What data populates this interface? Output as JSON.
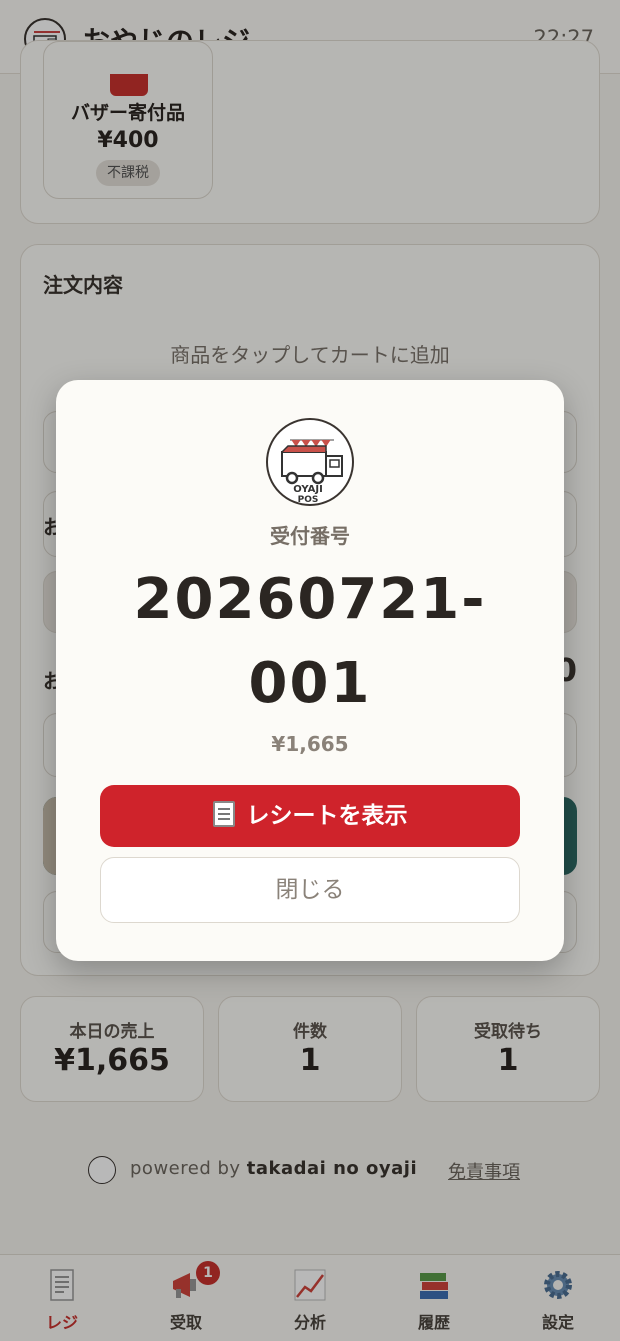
{
  "header": {
    "title": "おやじのレジ",
    "time": "22:27",
    "logo_icon": "oyaji-pos-logo-icon"
  },
  "product": {
    "name": "バザー寄付品",
    "price": "¥400",
    "tax": "不課税",
    "icon": "gift-icon"
  },
  "order": {
    "title": "注文内容",
    "empty": "商品をタップしてカートに追加",
    "partial_1": "お",
    "partial_2": "お",
    "partial_amount": "0"
  },
  "stats": [
    {
      "label": "本日の売上",
      "value": "¥1,665"
    },
    {
      "label": "件数",
      "value": "1"
    },
    {
      "label": "受取待ち",
      "value": "1"
    }
  ],
  "footer": {
    "powered_prefix": "powered by ",
    "powered_name": "takadai no oyaji",
    "disclaimer": "免責事項"
  },
  "tabs": [
    {
      "label": "レジ",
      "icon": "receipt-icon",
      "active": true
    },
    {
      "label": "受取",
      "icon": "megaphone-icon",
      "badge": "1"
    },
    {
      "label": "分析",
      "icon": "chart-icon"
    },
    {
      "label": "履歴",
      "icon": "books-icon"
    },
    {
      "label": "設定",
      "icon": "gear-icon"
    }
  ],
  "modal": {
    "label": "受付番号",
    "number_line1": "20260721-",
    "number_line2": "001",
    "amount": "¥1,665",
    "primary_button": "レシートを表示",
    "secondary_button": "閉じる",
    "logo_text_1": "OYAJI",
    "logo_text_2": "POS"
  },
  "colors": {
    "accent": "#cf232b",
    "teal": "#2f6b66",
    "background": "#f6f4ef"
  }
}
